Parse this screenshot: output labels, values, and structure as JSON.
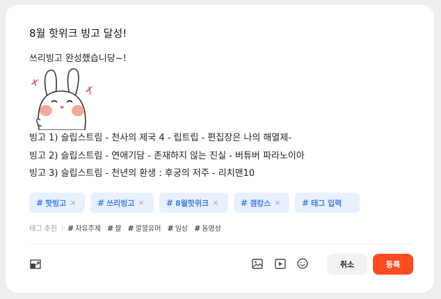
{
  "post": {
    "title": "8월 핫위크 빙고 달성!",
    "intro": "쓰리빙고 완성했습니당~!",
    "bingo_lines": [
      "빙고 1) 슬립스트림 - 천사의 제국 4 - 립트립 - 편집장은 나의 해열제-",
      "빙고 2) 슬립스트림 - 연애기담 - 존재하지 않는 진실 - 버튜버 파라노이아",
      "빙고 3) 슬립스트림 - 천년의 환생 : 후궁의 저주 - 리치맨10"
    ]
  },
  "tags": {
    "hash": "#",
    "remove": "×",
    "items": [
      "핫빙고",
      "쓰리빙고",
      "8월핫위크",
      "겜캉스"
    ],
    "input_placeholder": "태그 입력"
  },
  "recommend": {
    "label": "태그 추천",
    "items": [
      "자유주제",
      "짤",
      "깔깔유머",
      "일상",
      "동영상"
    ]
  },
  "toolbar": {
    "cancel_label": "취소",
    "submit_label": "등록"
  },
  "colors": {
    "accent": "#ff4a22",
    "tag_bg": "#e9f0fd",
    "tag_text": "#3f80ea"
  },
  "icons": [
    "resize-icon",
    "image-icon",
    "video-icon",
    "emoji-icon"
  ]
}
